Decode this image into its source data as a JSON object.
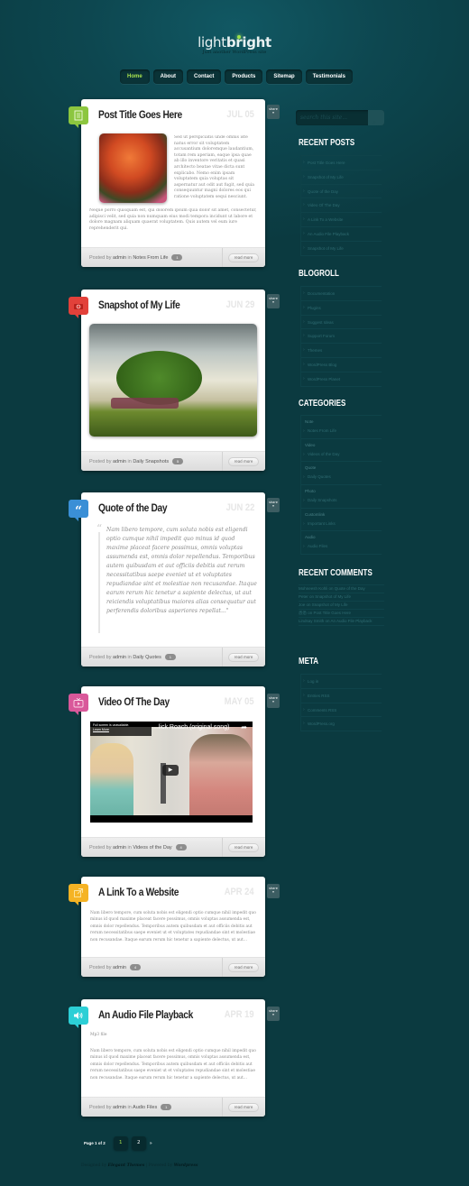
{
  "site": {
    "logo_light": "light",
    "logo_bright": "bright",
    "tagline": "Just another WordPress site"
  },
  "nav": [
    {
      "label": "Home",
      "active": true
    },
    {
      "label": "About"
    },
    {
      "label": "Contact"
    },
    {
      "label": "Products"
    },
    {
      "label": "Sitemap"
    },
    {
      "label": "Testimonials"
    }
  ],
  "posts": [
    {
      "type": "note",
      "icon": "note-icon",
      "color": "#8cc63f",
      "title": "Post Title Goes Here",
      "date": "JUL 05",
      "body_side": "Sed ut perspiciatis unde omnis iste natus error sit voluptatem accusantium doloremque laudantium, totam rem aperiam, eaque ipsa quae ab illo inventore veritatis et quasi architecto beatae vitae dicta sunt explicabo. Nemo enim ipsam voluptatem quia voluptas sit aspernatur aut odit aut fugit, sed quia consequuntur magni dolores eos qui ratione voluptatem sequi nesciunt.",
      "body_bottom": "Neque porro quisquam est, qui dolorem ipsum quia dolor sit amet, consectetur, adipisci velit, sed quia non numquam eius modi tempora incidunt ut labore et dolore magnam aliquam quaerat voluptatem. Quis autem vel eum iure reprehenderit qui.",
      "posted_by": "Posted by",
      "author": "admin",
      "in": "in",
      "category": "Notes From Life",
      "comments": "1",
      "read_more": "read more",
      "share": "share"
    },
    {
      "type": "photo",
      "icon": "camera-icon",
      "color": "#e2413a",
      "title": "Snapshot of My Life",
      "date": "JUN 29",
      "posted_by": "Posted by",
      "author": "admin",
      "in": "in",
      "category": "Daily Snapshots",
      "comments": "5",
      "read_more": "read more",
      "share": "share"
    },
    {
      "type": "quote",
      "icon": "quote-icon",
      "color": "#3a8fd6",
      "title": "Quote of the Day",
      "date": "JUN 22",
      "quote": "Nam libero tempore, cum soluta nobis est eligendi optio cumque nihil impedit quo minus id quod maxime placeat facere possimus, omnis voluptas assumenda est, omnis dolor repellendus. Temporibus autem quibusdam et aut officiis debitis aut rerum necessitatibus saepe eveniet ut et voluptates repudiandae sint et molestiae non recusandae. Itaque earum rerum hic tenetur a sapiente delectus, ut aut reiciendis voluptatibus maiores alias consequatur aut perferendis doloribus asperiores repellat...\"",
      "posted_by": "Posted by",
      "author": "admin",
      "in": "in",
      "category": "Daily Quotes",
      "comments": "1",
      "read_more": "read more",
      "share": "share"
    },
    {
      "type": "video",
      "icon": "tv-icon",
      "color": "#d9589a",
      "title": "Video Of The Day",
      "date": "MAY 05",
      "video_title": "...lick Roach (original song)",
      "video_notice": "Full screen is unavailable.",
      "video_learn_more": "Learn More",
      "posted_by": "Posted by",
      "author": "admin",
      "in": "in",
      "category": "Videos of the Day",
      "comments": "4",
      "read_more": "read more",
      "share": "share"
    },
    {
      "type": "link",
      "icon": "external-link-icon",
      "color": "#f5b324",
      "title": "A Link To a Website",
      "date": "APR 24",
      "body": "Nam libero tempore, cum soluta nobis est eligendi optio cumque nihil impedit quo minus id quod maxime placeat facere possimus, omnis voluptas assumenda est, omnis dolor repellendus. Temporibus autem quibusdam et aut officiis debitis aut rerum necessitatibus saepe eveniet ut et voluptates repudiandae sint et molestiae non recusandae. Itaque earum rerum hic tenetur a sapiente delectus, ut aut...",
      "posted_by": "Posted by",
      "author": "admin",
      "comments": "4",
      "read_more": "read more",
      "share": "share"
    },
    {
      "type": "audio",
      "icon": "speaker-icon",
      "color": "#2ccfd6",
      "title": "An Audio File Playback",
      "date": "APR 19",
      "file_label": "Mp3 file",
      "body": "Nam libero tempore, cum soluta nobis est eligendi optio cumque nihil impedit quo minus id quod maxime placeat facere possimus, omnis voluptas assumenda est, omnis dolor repellendus. Temporibus autem quibusdam et aut officiis debitis aut rerum necessitatibus saepe eveniet ut et voluptates repudiandae sint et molestiae non recusandae. Itaque earum rerum hic tenetur a sapiente delectus, ut aut...",
      "posted_by": "Posted by",
      "author": "admin",
      "in": "in",
      "category": "Audio Files",
      "comments": "1",
      "read_more": "read more",
      "share": "share"
    }
  ],
  "sidebar": {
    "search_placeholder": "search this site...",
    "recent_posts": {
      "title": "RECENT POSTS",
      "items": [
        "Post Title Goes Here",
        "Snapshot of My Life",
        "Quote of the Day",
        "Video Of The Day",
        "A Link To a Website",
        "An Audio File Playback",
        "Snapshot of My Life"
      ]
    },
    "blogroll": {
      "title": "BLOGROLL",
      "items": [
        "Documentation",
        "Plugins",
        "Suggest Ideas",
        "Support Forum",
        "Themes",
        "WordPress Blog",
        "WordPress Planet"
      ]
    },
    "categories": {
      "title": "CATEGORIES",
      "groups": [
        {
          "heading": "Note",
          "item": "Notes From Life"
        },
        {
          "heading": "Video",
          "item": "Videos of the Day"
        },
        {
          "heading": "Quote",
          "item": "Daily Quotes"
        },
        {
          "heading": "Photo",
          "item": "Daily Snapshots"
        },
        {
          "heading": "Customlink",
          "item": "Important Links"
        },
        {
          "heading": "Audio",
          "item": "Audio Files"
        }
      ]
    },
    "recent_comments": {
      "title": "RECENT COMMENTS",
      "items": [
        "Mohneesh Kohli on Quote of the Day",
        "Peter on Snapshot of My Life",
        "Joe on Snapshot of My Life",
        "悉悉 on Post Title Goes Here",
        "Lindsay Smith on An Audio File Playback"
      ]
    },
    "meta": {
      "title": "META",
      "items": [
        "Log in",
        "Entries RSS",
        "Comments RSS",
        "WordPress.org"
      ]
    }
  },
  "pagination": {
    "label": "Page 1 of 2",
    "pages": [
      "1",
      "2"
    ],
    "current": "1",
    "next": "»"
  },
  "footer": {
    "designed_by": "Designed by",
    "designer": "Elegant Themes",
    "separator": "|",
    "powered_by": "Powered by",
    "platform": "Wordpress"
  }
}
